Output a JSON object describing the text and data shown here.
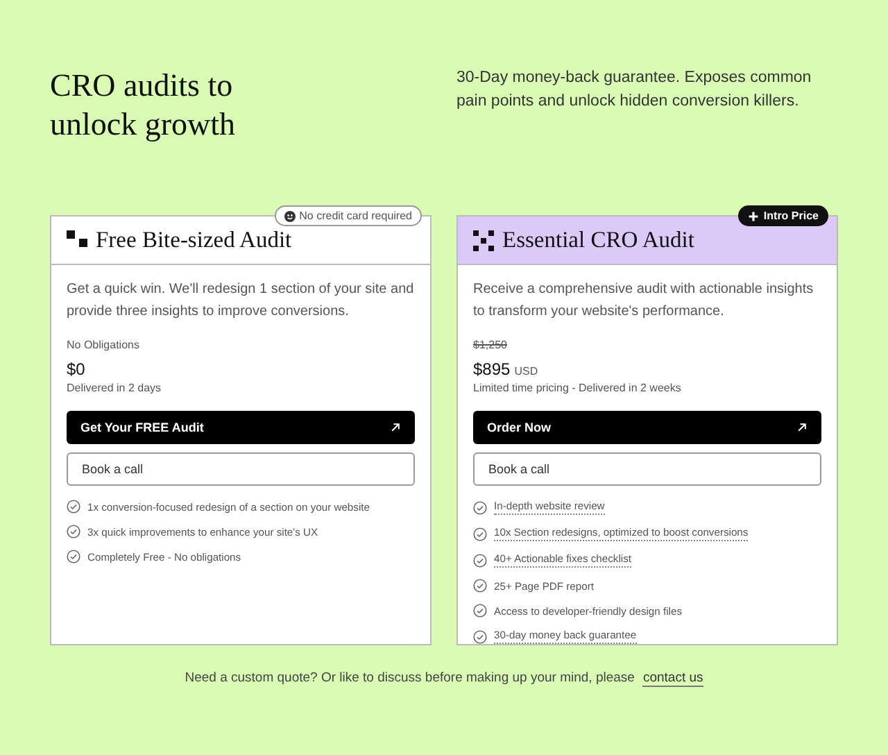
{
  "hero": {
    "title": "CRO audits to unlock growth",
    "subtitle": "30-Day money-back guarantee. Exposes common pain points and unlock hidden conversion killers."
  },
  "plans": [
    {
      "name": "Free Bite-sized Audit",
      "highlighted": false,
      "badge": {
        "text": "No credit card required",
        "kind": "outline"
      },
      "description": "Get a quick win. We'll redesign 1 section of your site and provide three insights to improve conversions.",
      "price_note": "No Obligations",
      "price": "$0",
      "delivery": "Delivered in 2 days",
      "primary_button": "Get Your FREE Audit",
      "secondary_button": "Book a call",
      "features": [
        {
          "text": "1x conversion-focused redesign of a section on your website",
          "underlined": false
        },
        {
          "text": "3x quick improvements to enhance your site's UX",
          "underlined": false
        },
        {
          "text": "Completely Free - No obligations",
          "underlined": false
        }
      ]
    },
    {
      "name": "Essential CRO Audit",
      "highlighted": true,
      "badge": {
        "text": "Intro Price",
        "kind": "dark"
      },
      "description": "Receive a comprehensive audit with actionable insights to transform your website's performance.",
      "old_price": "$1,250",
      "price": "$895",
      "currency": "USD",
      "delivery": "Limited time pricing - Delivered in 2 weeks",
      "primary_button": "Order Now",
      "secondary_button": "Book a call",
      "features": [
        {
          "text": "In-depth website review",
          "underlined": true
        },
        {
          "text": "10x Section redesigns, optimized to boost conversions",
          "underlined": true
        },
        {
          "text": "40+ Actionable fixes checklist",
          "underlined": true
        },
        {
          "text": "25+ Page PDF report",
          "underlined": false
        },
        {
          "text": "Access to developer-friendly design files",
          "underlined": false
        },
        {
          "text": "30-day money back guarantee",
          "underlined": true
        }
      ]
    }
  ],
  "footer": {
    "text": "Need a custom quote? Or like to discuss before making up your mind, please",
    "link": "contact us"
  }
}
